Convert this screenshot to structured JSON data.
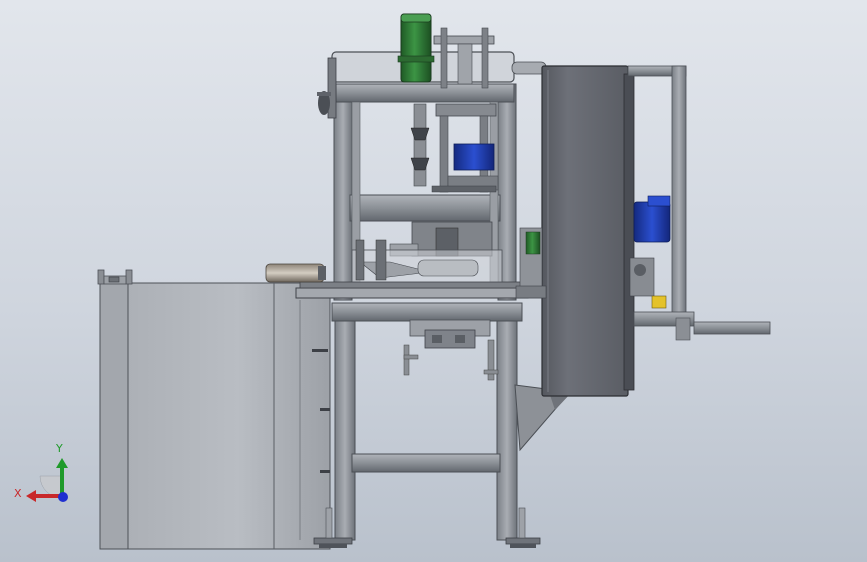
{
  "viewport": {
    "background_top": "#e2e6ec",
    "background_bottom": "#b9c1cc"
  },
  "triad": {
    "x_label": "X",
    "y_label": "Y",
    "x_color": "#c8282a",
    "y_color": "#1f9a2a",
    "z_color": "#1f2fd0"
  },
  "colors": {
    "frame": "#8f949a",
    "frame_dark": "#5f646b",
    "panel": "#b4b8be",
    "cabinet": "#6b6e76",
    "motor_green": "#2f7a35",
    "motor_blue": "#1f3fae",
    "accent_yellow": "#e4c22a"
  }
}
